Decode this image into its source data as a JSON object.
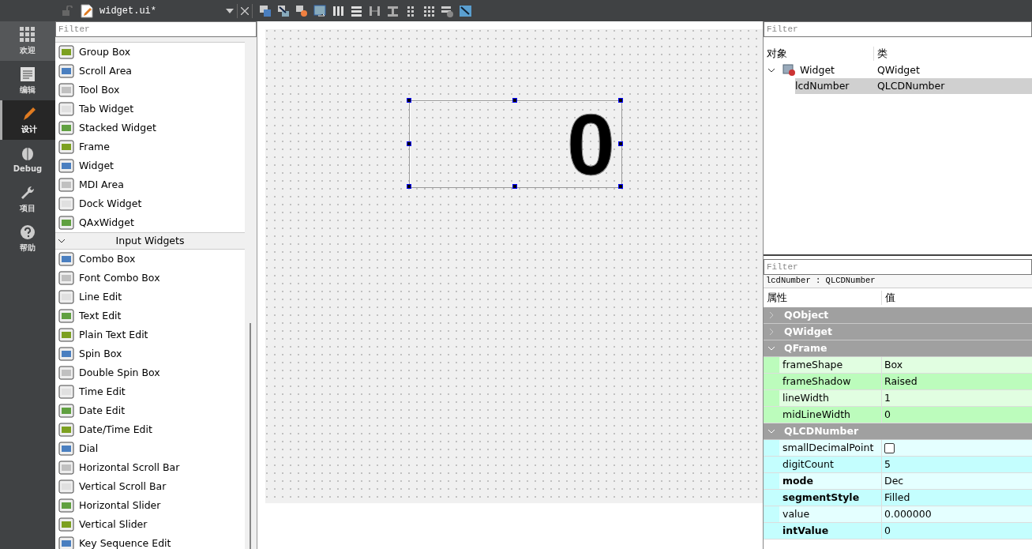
{
  "modes": [
    {
      "label": "欢迎",
      "selected": false
    },
    {
      "label": "编辑",
      "selected": false
    },
    {
      "label": "设计",
      "selected": true
    },
    {
      "label": "Debug",
      "selected": false
    },
    {
      "label": "项目",
      "selected": false
    },
    {
      "label": "帮助",
      "selected": false
    }
  ],
  "editor": {
    "file": "widget.ui*"
  },
  "widget_box": {
    "filter_placeholder": "Filter",
    "groups": [
      {
        "items": [
          "Group Box",
          "Scroll Area",
          "Tool Box",
          "Tab Widget",
          "Stacked Widget",
          "Frame",
          "Widget",
          "MDI Area",
          "Dock Widget",
          "QAxWidget"
        ]
      },
      {
        "title": "Input Widgets",
        "expanded": true,
        "items": [
          "Combo Box",
          "Font Combo Box",
          "Line Edit",
          "Text Edit",
          "Plain Text Edit",
          "Spin Box",
          "Double Spin Box",
          "Time Edit",
          "Date Edit",
          "Date/Time Edit",
          "Dial",
          "Horizontal Scroll Bar",
          "Vertical Scroll Bar",
          "Horizontal Slider",
          "Vertical Slider",
          "Key Sequence Edit"
        ]
      }
    ]
  },
  "form": {
    "lcd_display": "0",
    "selected": true
  },
  "object_inspector": {
    "filter_placeholder": "Filter",
    "columns": [
      "对象",
      "类"
    ],
    "tree": [
      {
        "name": "Widget",
        "class": "QWidget",
        "expanded": true,
        "selected": false,
        "children": [
          {
            "name": "lcdNumber",
            "class": "QLCDNumber",
            "selected": true
          }
        ]
      }
    ]
  },
  "property_editor": {
    "filter_placeholder": "Filter",
    "object_label": "lcdNumber : QLCDNumber",
    "columns": [
      "属性",
      "值"
    ],
    "groups": [
      {
        "title": "QObject",
        "expanded": false
      },
      {
        "title": "QWidget",
        "expanded": false
      },
      {
        "title": "QFrame",
        "expanded": true,
        "color": "#bcfcbc",
        "properties": [
          {
            "name": "frameShape",
            "value": "Box",
            "modified": false,
            "kind": "text"
          },
          {
            "name": "frameShadow",
            "value": "Raised",
            "modified": false,
            "kind": "text"
          },
          {
            "name": "lineWidth",
            "value": "1",
            "modified": false,
            "kind": "text"
          },
          {
            "name": "midLineWidth",
            "value": "0",
            "modified": false,
            "kind": "text"
          }
        ]
      },
      {
        "title": "QLCDNumber",
        "expanded": true,
        "color": "#c4fefe",
        "properties": [
          {
            "name": "smallDecimalPoint",
            "checked": false,
            "modified": false,
            "kind": "checkbox"
          },
          {
            "name": "digitCount",
            "value": "5",
            "modified": false,
            "kind": "text"
          },
          {
            "name": "mode",
            "value": "Dec",
            "modified": true,
            "kind": "text"
          },
          {
            "name": "segmentStyle",
            "value": "Filled",
            "modified": true,
            "kind": "text"
          },
          {
            "name": "value",
            "value": "0.000000",
            "modified": false,
            "kind": "text"
          },
          {
            "name": "intValue",
            "value": "0",
            "modified": true,
            "kind": "text"
          }
        ]
      }
    ]
  }
}
